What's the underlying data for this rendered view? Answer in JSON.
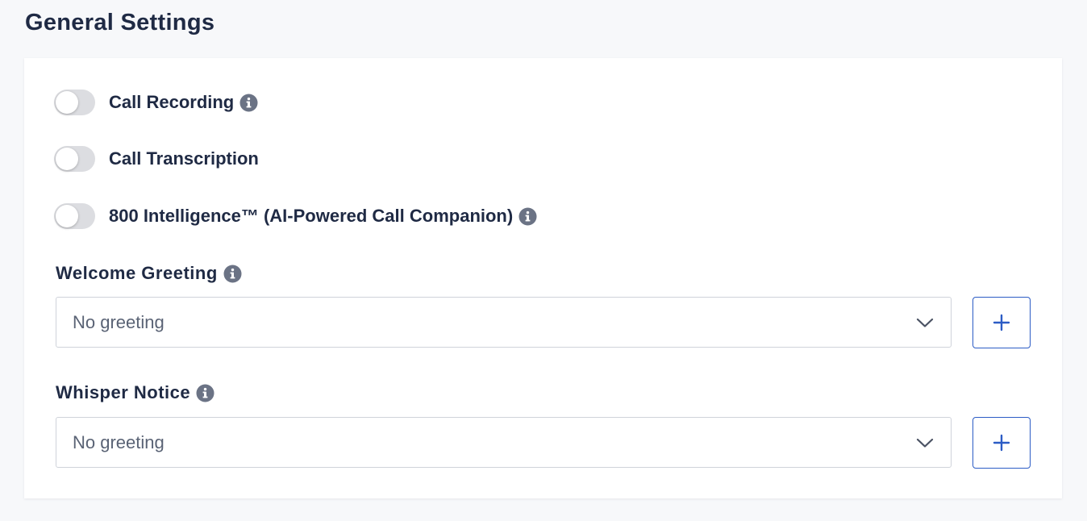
{
  "page": {
    "title": "General Settings"
  },
  "toggles": [
    {
      "label": "Call Recording",
      "enabled": false,
      "has_info": true
    },
    {
      "label": "Call Transcription",
      "enabled": false,
      "has_info": false
    },
    {
      "label": "800 Intelligence™ (AI-Powered Call Companion)",
      "enabled": false,
      "has_info": true
    }
  ],
  "welcome_greeting": {
    "label": "Welcome Greeting",
    "value": "No greeting",
    "add_icon": "plus-icon"
  },
  "whisper_notice": {
    "label": "Whisper Notice",
    "value": "No greeting",
    "add_icon": "plus-icon"
  },
  "icons": {
    "info": "info-icon",
    "dropdown": "chevron-down-icon"
  },
  "colors": {
    "text": "#1f2a44",
    "toggle_off": "#dcdde1",
    "info_icon": "#6b7385",
    "accent": "#2c5cc5",
    "background": "#f7f8fa"
  }
}
